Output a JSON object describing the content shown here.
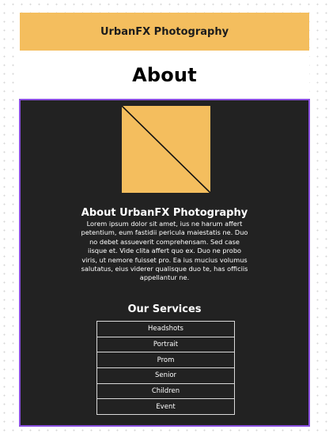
{
  "header": {
    "title": "UrbanFX Photography"
  },
  "page": {
    "title": "About"
  },
  "colors": {
    "accent": "#f4be5e",
    "panel": "#222222",
    "panel_border": "#8a4fe0"
  },
  "hero": {
    "icon": "image-placeholder-icon"
  },
  "about": {
    "heading": "About UrbanFX Photography",
    "body": "Lorem ipsum dolor sit amet, ius ne harum affert petentium, eum fastidii pericula maiestatis ne. Duo no debet assueverit comprehensam. Sed case iisque et. Vide clita affert quo ex. Duo ne probo viris, ut nemore fuisset pro. Ea ius mucius volumus salutatus, eius viderer qualisque duo te, has officiis appellantur ne."
  },
  "services": {
    "heading": "Our Services",
    "items": [
      "Headshots",
      "Portrait",
      "Prom",
      "Senior",
      "Children",
      "Event"
    ]
  }
}
